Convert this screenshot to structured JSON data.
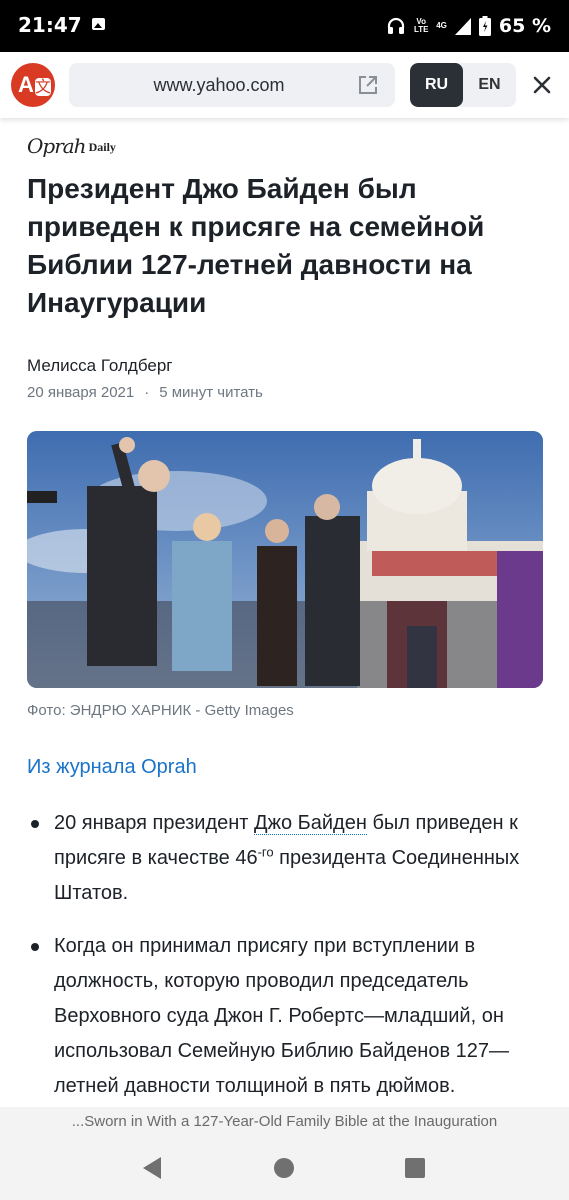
{
  "status_bar": {
    "time": "21:47",
    "network_text": "Vo LTE",
    "network_gen": "4G",
    "battery": "65 %"
  },
  "translate_bar": {
    "url": "www.yahoo.com",
    "languages": [
      "RU",
      "EN"
    ],
    "active_language": "RU",
    "logo_letter": "A",
    "logo_secondary": "文"
  },
  "article": {
    "publication_logo": "Oprah",
    "publication_logo_suffix": "Daily",
    "headline": "Президент Джо Байден был приведен к присяге на семейной Библии 127-летней давности на Инаугурации",
    "author": "Мелисса Голдберг",
    "date": "20 января 2021",
    "separator": "·",
    "read_time": "5 минут читать",
    "photo_caption": "Фото: ЭНДРЮ ХАРНИК - Getty Images",
    "source_link": "Из журнала Oprah",
    "bullet1": {
      "before": "20 января президент ",
      "link": "Джо Байден",
      "middle": " был приведен к присяге в качестве 46",
      "sup": "-го",
      "after": " президента Соединенных Штатов."
    },
    "bullet2": "Когда он принимал присягу при вступлении в должность, которую проводил председатель Верховного суда Джон Г. Робертс—младший, он использовал Семейную Библию Байденов 127—летней давности толщиной в пять дюймов."
  },
  "bottom": {
    "page_title": "...Sworn in With a 127-Year-Old Family Bible at the Inauguration"
  }
}
